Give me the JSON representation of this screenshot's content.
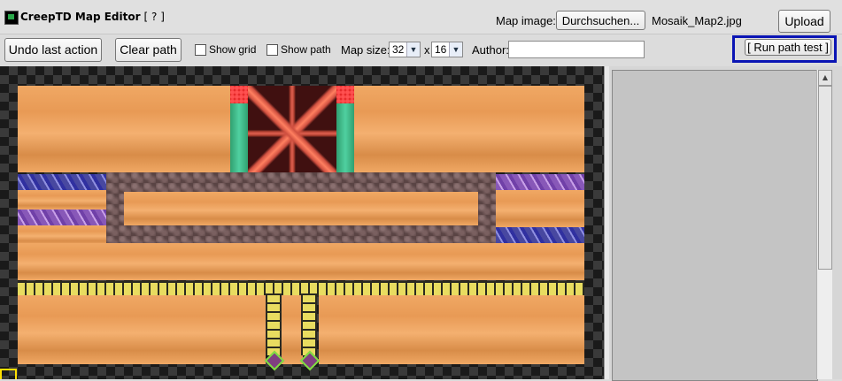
{
  "header": {
    "title": "CreepTD Map Editor",
    "help_link": "[ ? ]",
    "map_image_label": "Map image:",
    "browse_button": "Durchsuchen...",
    "filename": "Mosaik_Map2.jpg",
    "upload_button": "Upload"
  },
  "toolbar": {
    "undo_button": "Undo last action",
    "clear_path_button": "Clear path",
    "show_grid_label": "Show grid",
    "show_path_label": "Show path",
    "map_size_label": "Map size:",
    "map_width": "32",
    "times": "x",
    "map_height": "16",
    "author_label": "Author:",
    "author_value": "",
    "run_path_test_button": "[ Run path test ]"
  },
  "colors": {
    "highlight_border": "#0a14b4",
    "sand": "#f0a864",
    "rail": "#e8dc60"
  }
}
